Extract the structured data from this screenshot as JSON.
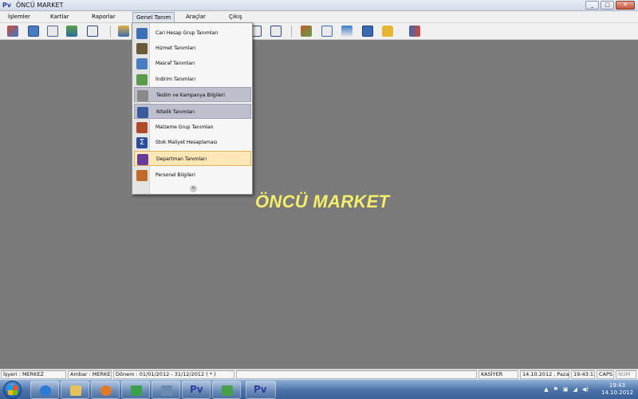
{
  "window": {
    "title": "ÖNCÜ MARKET",
    "controls": [
      "_",
      "□",
      "✕"
    ]
  },
  "menubar": [
    {
      "id": "islemler",
      "label": "İşlemler"
    },
    {
      "id": "kartlar",
      "label": "Kartlar"
    },
    {
      "id": "raporlar",
      "label": "Raporlar"
    },
    {
      "id": "genel_tanim",
      "label": "Genel Tanım"
    },
    {
      "id": "araclar",
      "label": "Araçlar"
    },
    {
      "id": "cikis",
      "label": "Çıkış"
    }
  ],
  "dropdown": {
    "items": [
      {
        "label": "Cari Hesap Grup Tanımları",
        "icon": "group-calendar-icon",
        "color": "#3d6fb8",
        "state": "normal"
      },
      {
        "label": "Hizmet Tanımları",
        "icon": "tools-icon",
        "color": "#6a5a3a",
        "state": "normal"
      },
      {
        "label": "Masraf Tanımları",
        "icon": "document-list-icon",
        "color": "#4a7cc2",
        "state": "normal"
      },
      {
        "label": "İndirim Tanımları",
        "icon": "discount-sheet-icon",
        "color": "#5a9a4a",
        "state": "normal"
      },
      {
        "label": "Teslim ve Kampanya Bilgileri",
        "icon": "delivery-icon",
        "color": "#8a8a8a",
        "state": "selected"
      },
      {
        "label": "Nitelik Tanımları",
        "icon": "attribute-list-icon",
        "color": "#3a5a9a",
        "state": "selected"
      },
      {
        "label": "Malzeme Grup Tanımları",
        "icon": "box-group-icon",
        "color": "#b04a2a",
        "state": "normal"
      },
      {
        "label": "Stok Maliyet Hesaplaması",
        "icon": "sigma-icon",
        "color": "#2a4a9a",
        "state": "normal"
      },
      {
        "label": "Departman Tanımları",
        "icon": "department-icon",
        "color": "#6a3a9a",
        "state": "hover"
      },
      {
        "label": "Personel Bilgileri",
        "icon": "personnel-icon",
        "color": "#c26a2a",
        "state": "normal"
      }
    ],
    "more_glyph": "»"
  },
  "workspace": {
    "title": "ÖNCÜ MARKET"
  },
  "statusbar": {
    "isyeri": "İşyeri : MERKEZ",
    "ambar": "Ambar : MERKEZ AMBAR",
    "donem": "Dönem : 01/01/2012 - 31/12/2012 ( * )",
    "user": "KASİYER",
    "date": "14.10.2012 , Pazar",
    "time": "19:43:12",
    "caps": "CAPS",
    "num": "NUM"
  },
  "taskbar": {
    "clock_time": "19:43",
    "clock_date": "14.10.2012",
    "pinned": [
      {
        "name": "ie-icon",
        "color": "#2b7bd6"
      },
      {
        "name": "folder-icon",
        "color": "#e6c35a"
      },
      {
        "name": "media-player-icon",
        "color": "#e07a2a"
      },
      {
        "name": "people-icon",
        "color": "#3aa04a"
      },
      {
        "name": "tools-icon",
        "color": "#6a8ab0"
      },
      {
        "name": "pv-app-icon",
        "color": "#2d3fa0"
      },
      {
        "name": "person-app-icon",
        "color": "#4aa04a"
      },
      {
        "name": "pv-app-icon",
        "color": "#2d3fa0"
      }
    ],
    "tray": [
      "▲",
      "⚑",
      "▣",
      "◢",
      "◀)"
    ]
  }
}
